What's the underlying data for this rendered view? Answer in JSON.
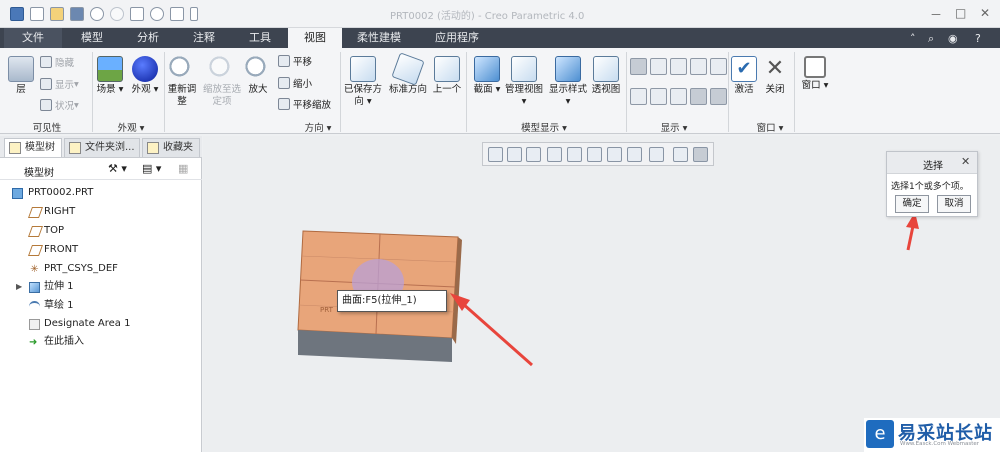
{
  "window": {
    "title": "PRT0002 (活动的) - Creo Parametric 4.0",
    "minimize": "－",
    "maximize": "□",
    "close": "✕"
  },
  "menu_tabs": [
    "文件",
    "模型",
    "分析",
    "注释",
    "工具",
    "视图",
    "柔性建模",
    "应用程序"
  ],
  "active_tab": "视图",
  "ribbon": {
    "visibility": {
      "layer": "层",
      "hide": "隐藏",
      "show": "显示",
      "status": "状况",
      "group": "可见性"
    },
    "appearance": {
      "scene": "场景",
      "appearance": "外观",
      "group": "外观"
    },
    "orientation": {
      "refit": "重新调整",
      "zoom_selected": "缩放至选定项",
      "zoom_in": "放大",
      "pan": "平移",
      "zoom_out": "缩小",
      "pan_zoom": "平移缩放",
      "group": "方向"
    },
    "saved": {
      "saved_orientations": "已保存方向",
      "standard": "标准方向",
      "previous": "上一个"
    },
    "model_display": {
      "section": "截面",
      "manage_views": "管理视图",
      "display_style": "显示样式",
      "perspective": "透视图",
      "group": "模型显示"
    },
    "show": {
      "group": "显示"
    },
    "window": {
      "activate": "激活",
      "close": "关闭",
      "windows": "窗口",
      "group": "窗口"
    }
  },
  "left_panel": {
    "tabs": [
      "模型树",
      "文件夹浏...",
      "收藏夹"
    ],
    "tree_header": "模型树",
    "items": [
      {
        "label": "PRT0002.PRT",
        "icon": "part-icon"
      },
      {
        "label": "RIGHT",
        "icon": "datum-plane-icon"
      },
      {
        "label": "TOP",
        "icon": "datum-plane-icon"
      },
      {
        "label": "FRONT",
        "icon": "datum-plane-icon"
      },
      {
        "label": "PRT_CSYS_DEF",
        "icon": "csys-icon"
      },
      {
        "label": "拉伸 1",
        "icon": "extrude-icon"
      },
      {
        "label": "草绘 1",
        "icon": "sketch-icon"
      },
      {
        "label": "Designate Area 1",
        "icon": "designate-area-icon"
      },
      {
        "label": "在此插入",
        "icon": "insert-here-icon"
      }
    ]
  },
  "graphics": {
    "tooltip": "曲面:F5(拉伸_1)",
    "model_label": "PRT"
  },
  "select_dialog": {
    "title": "选择",
    "message": "选择1个或多个项。",
    "ok": "确定",
    "cancel": "取消"
  },
  "watermark": {
    "brand": "易采站长站",
    "url": "Www.Easck.Com Webmaster"
  },
  "colors": {
    "accent": "#1f6cbf",
    "model_face": "#e8a57a",
    "model_side": "#6e757e",
    "arrow": "#e8453c"
  }
}
